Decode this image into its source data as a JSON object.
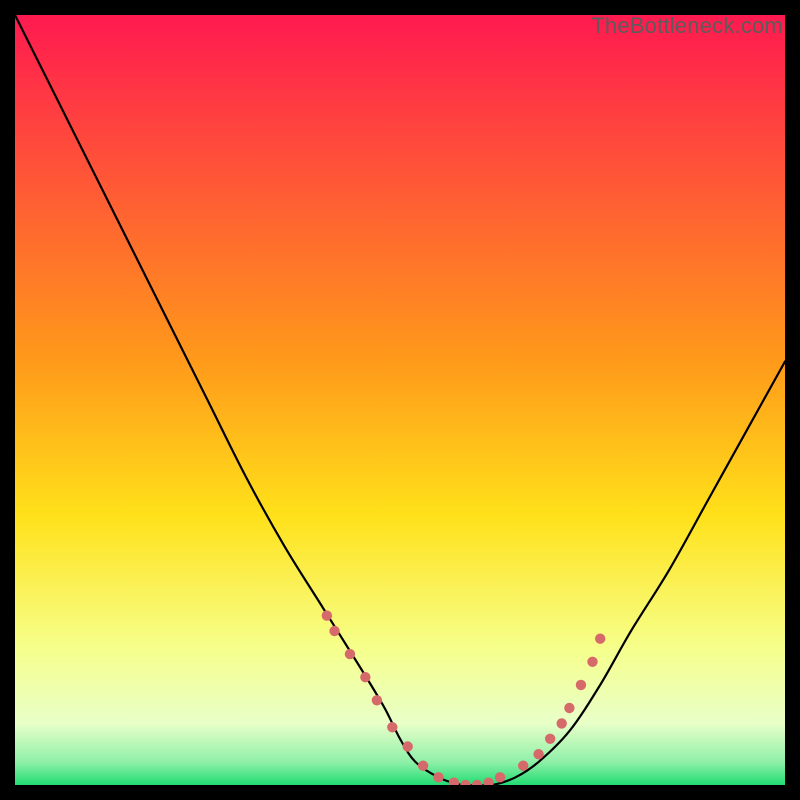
{
  "attribution": "TheBottleneck.com",
  "colors": {
    "bg": "#000000",
    "gradient_top": "#ff1a50",
    "gradient_mid_upper": "#ff7a2a",
    "gradient_mid": "#ffd21a",
    "gradient_lower": "#f7ff66",
    "gradient_pale": "#ecffcc",
    "gradient_bottom": "#28e07a",
    "curve": "#000000",
    "dots": "#d66a6a"
  },
  "chart_data": {
    "type": "line",
    "title": "",
    "xlabel": "",
    "ylabel": "",
    "xlim": [
      0,
      100
    ],
    "ylim": [
      0,
      100
    ],
    "grid": false,
    "series": [
      {
        "name": "bottleneck-curve",
        "x": [
          0,
          3,
          6,
          10,
          15,
          20,
          25,
          30,
          35,
          40,
          45,
          48,
          50,
          52,
          55,
          58,
          60,
          62,
          65,
          68,
          72,
          76,
          80,
          85,
          90,
          95,
          100
        ],
        "y": [
          100,
          94,
          88,
          80,
          70,
          60,
          50,
          40,
          31,
          23,
          15,
          10,
          6,
          3,
          1,
          0,
          0,
          0,
          1,
          3,
          7,
          13,
          20,
          28,
          37,
          46,
          55
        ]
      }
    ],
    "highlight_dots": {
      "name": "range-markers",
      "x": [
        40.5,
        41.5,
        43.5,
        45.5,
        47.0,
        49.0,
        51.0,
        53.0,
        55.0,
        57.0,
        58.5,
        60.0,
        61.5,
        63.0,
        66.0,
        68.0,
        69.5,
        71.0,
        72.0,
        73.5,
        75.0,
        76.0
      ],
      "y": [
        22.0,
        20.0,
        17.0,
        14.0,
        11.0,
        7.5,
        5.0,
        2.5,
        1.0,
        0.3,
        0.0,
        0.0,
        0.3,
        1.0,
        2.5,
        4.0,
        6.0,
        8.0,
        10.0,
        13.0,
        16.0,
        19.0
      ]
    },
    "gradient_bands": [
      {
        "y": 100,
        "color": "#ff1a50"
      },
      {
        "y": 55,
        "color": "#ff9a1a"
      },
      {
        "y": 35,
        "color": "#ffe11a"
      },
      {
        "y": 18,
        "color": "#f6ff8a"
      },
      {
        "y": 8,
        "color": "#e8ffc8"
      },
      {
        "y": 3,
        "color": "#8ff0a8"
      },
      {
        "y": 0,
        "color": "#22dc72"
      }
    ]
  }
}
